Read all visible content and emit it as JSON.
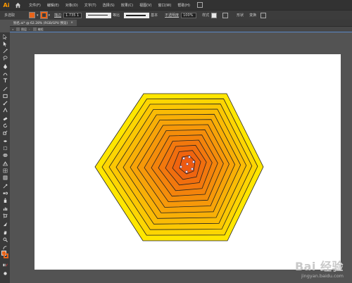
{
  "app": {
    "logo": "Ai"
  },
  "menubar": {
    "items": [
      "文件(F)",
      "编辑(E)",
      "对象(O)",
      "文字(T)",
      "选择(S)",
      "效果(C)",
      "视图(V)",
      "窗口(W)",
      "帮助(H)"
    ]
  },
  "controlbar": {
    "selection_label": "多选取",
    "stroke_label": "描边",
    "stroke_value": "1.735 1",
    "stroke_profile_label": "等比",
    "brush_label": "基本",
    "opacity_label": "不透明度",
    "opacity_value": "100%",
    "style_label": "样式",
    "shape_label": "形状",
    "transform_label": "变换",
    "fill_color": "#e8651b"
  },
  "document": {
    "tab_title": "别名.ai* @ 62.28% (RGB/GPU 预览)",
    "close": "×"
  },
  "breadcrumb": {
    "items": [
      "图层",
      "编组"
    ]
  },
  "artwork": {
    "outer_color": "#ffe600",
    "inner_color": "#ee5a10",
    "stroke_color": "#222222"
  },
  "watermark": {
    "logo": "Bai 经验",
    "url": "jingyan.baidu.com"
  }
}
